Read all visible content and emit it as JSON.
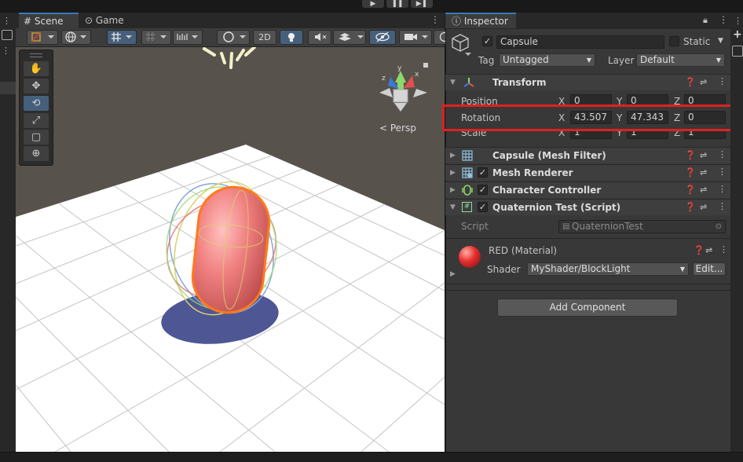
{
  "toolbar_top": {
    "play": "▶",
    "pause": "❚❚",
    "step": "▶❚"
  },
  "scene_tabs": [
    {
      "icon": "#",
      "label": "Scene"
    },
    {
      "icon": "⊙",
      "label": "Game"
    }
  ],
  "scene_toolbar": {
    "mode_2d": "2D",
    "persp_label": "< Persp"
  },
  "gizmo_axes": {
    "x": "x",
    "y": "y",
    "z": "z"
  },
  "inspector": {
    "tab_label": "Inspector",
    "object": {
      "name": "Capsule",
      "active": true,
      "static_label": "Static",
      "tag_label": "Tag",
      "tag_value": "Untagged",
      "layer_label": "Layer",
      "layer_value": "Default"
    },
    "transform": {
      "title": "Transform",
      "position": {
        "label": "Position",
        "x": "0",
        "y": "0",
        "z": "0"
      },
      "rotation": {
        "label": "Rotation",
        "x": "43.507",
        "y": "47.343",
        "z": "0"
      },
      "scale": {
        "label": "Scale",
        "x": "1",
        "y": "1",
        "z": "1"
      },
      "axis_x": "X",
      "axis_y": "Y",
      "axis_z": "Z"
    },
    "components": [
      {
        "title": "Capsule (Mesh Filter)",
        "checkbox": false
      },
      {
        "title": "Mesh Renderer",
        "checkbox": true
      },
      {
        "title": "Character Controller",
        "checkbox": true
      },
      {
        "title": "Quaternion Test (Script)",
        "checkbox": true
      }
    ],
    "script": {
      "label": "Script",
      "value": "QuaternionTest"
    },
    "material": {
      "name": "RED (Material)",
      "shader_label": "Shader",
      "shader_value": "MyShader/BlockLight",
      "edit_label": "Edit..."
    },
    "add_component": "Add Component"
  },
  "colors": {
    "highlight_box": "#e02020",
    "accent": "#3a79bb",
    "capsule": "#f07f7f",
    "selection_outline": "#ff7a1a"
  }
}
